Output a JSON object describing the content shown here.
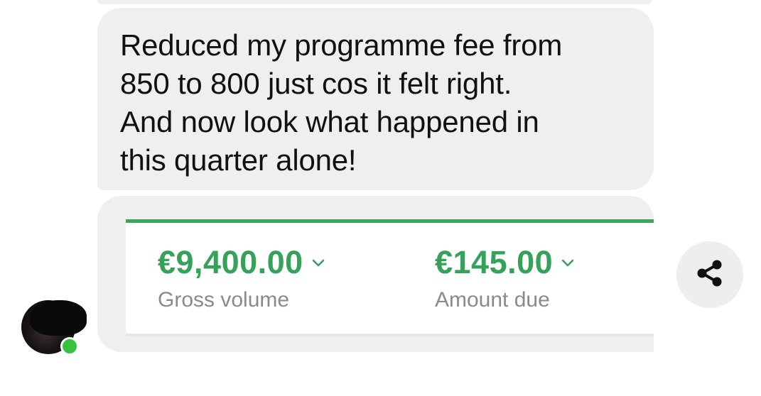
{
  "message": {
    "text": "Reduced my programme fee from\n850 to 800 just cos it felt right.\nAnd now look what happened in\nthis quarter alone!"
  },
  "card": {
    "metrics": [
      {
        "value": "€9,400.00",
        "label": "Gross volume",
        "icon": "chevron-down-icon"
      },
      {
        "value": "€145.00",
        "label": "Amount due",
        "icon": "chevron-down-icon"
      }
    ],
    "accent_color": "#3aa65c"
  },
  "actions": {
    "share_icon": "share-icon"
  },
  "sender": {
    "avatar_icon": "avatar",
    "online": true,
    "online_color": "#34c23f"
  }
}
